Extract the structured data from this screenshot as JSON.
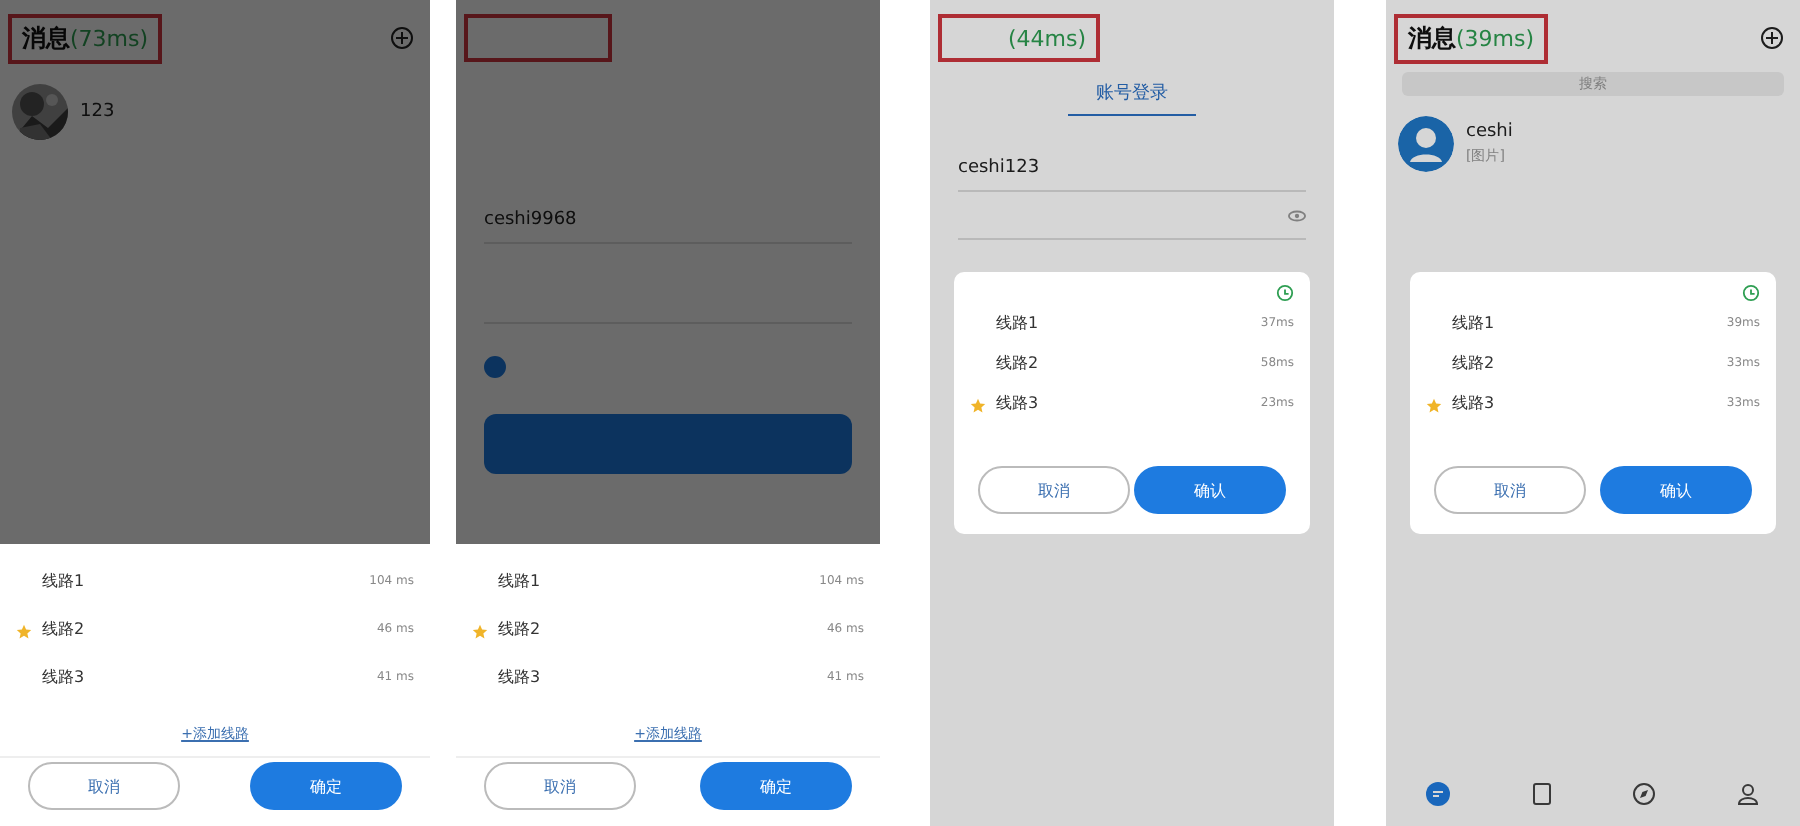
{
  "screens": [
    {
      "kind": "messages",
      "title": "消息",
      "latency": "(73ms)",
      "chats": [
        {
          "name": "123"
        }
      ],
      "picker": {
        "add_link": "+添加线路",
        "cancel": "取消",
        "confirm": "确定",
        "lines": [
          {
            "name": "线路1",
            "latency": "104 ms",
            "selected": false
          },
          {
            "name": "线路2",
            "latency": "46 ms",
            "selected": true
          },
          {
            "name": "线路3",
            "latency": "41 ms",
            "selected": false
          }
        ]
      }
    },
    {
      "kind": "login",
      "username": "ceshi9968",
      "agree_checked": true,
      "picker": {
        "add_link": "+添加线路",
        "cancel": "取消",
        "confirm": "确定",
        "lines": [
          {
            "name": "线路1",
            "latency": "104 ms",
            "selected": false
          },
          {
            "name": "线路2",
            "latency": "46 ms",
            "selected": true
          },
          {
            "name": "线路3",
            "latency": "41 ms",
            "selected": false
          }
        ]
      }
    },
    {
      "kind": "account_login",
      "latency": "(44ms)",
      "tab": "账号登录",
      "username": "ceshi123",
      "picker": {
        "cancel": "取消",
        "confirm": "确认",
        "lines": [
          {
            "name": "线路1",
            "latency": "37ms",
            "selected": false
          },
          {
            "name": "线路2",
            "latency": "58ms",
            "selected": false
          },
          {
            "name": "线路3",
            "latency": "23ms",
            "selected": true
          }
        ]
      }
    },
    {
      "kind": "messages",
      "title": "消息",
      "latency": "(39ms)",
      "search": "搜索",
      "chats": [
        {
          "name": "ceshi",
          "preview": "[图片]"
        }
      ],
      "picker": {
        "cancel": "取消",
        "confirm": "确认",
        "lines": [
          {
            "name": "线路1",
            "latency": "39ms",
            "selected": false
          },
          {
            "name": "线路2",
            "latency": "33ms",
            "selected": false
          },
          {
            "name": "线路3",
            "latency": "33ms",
            "selected": true
          }
        ]
      }
    }
  ]
}
